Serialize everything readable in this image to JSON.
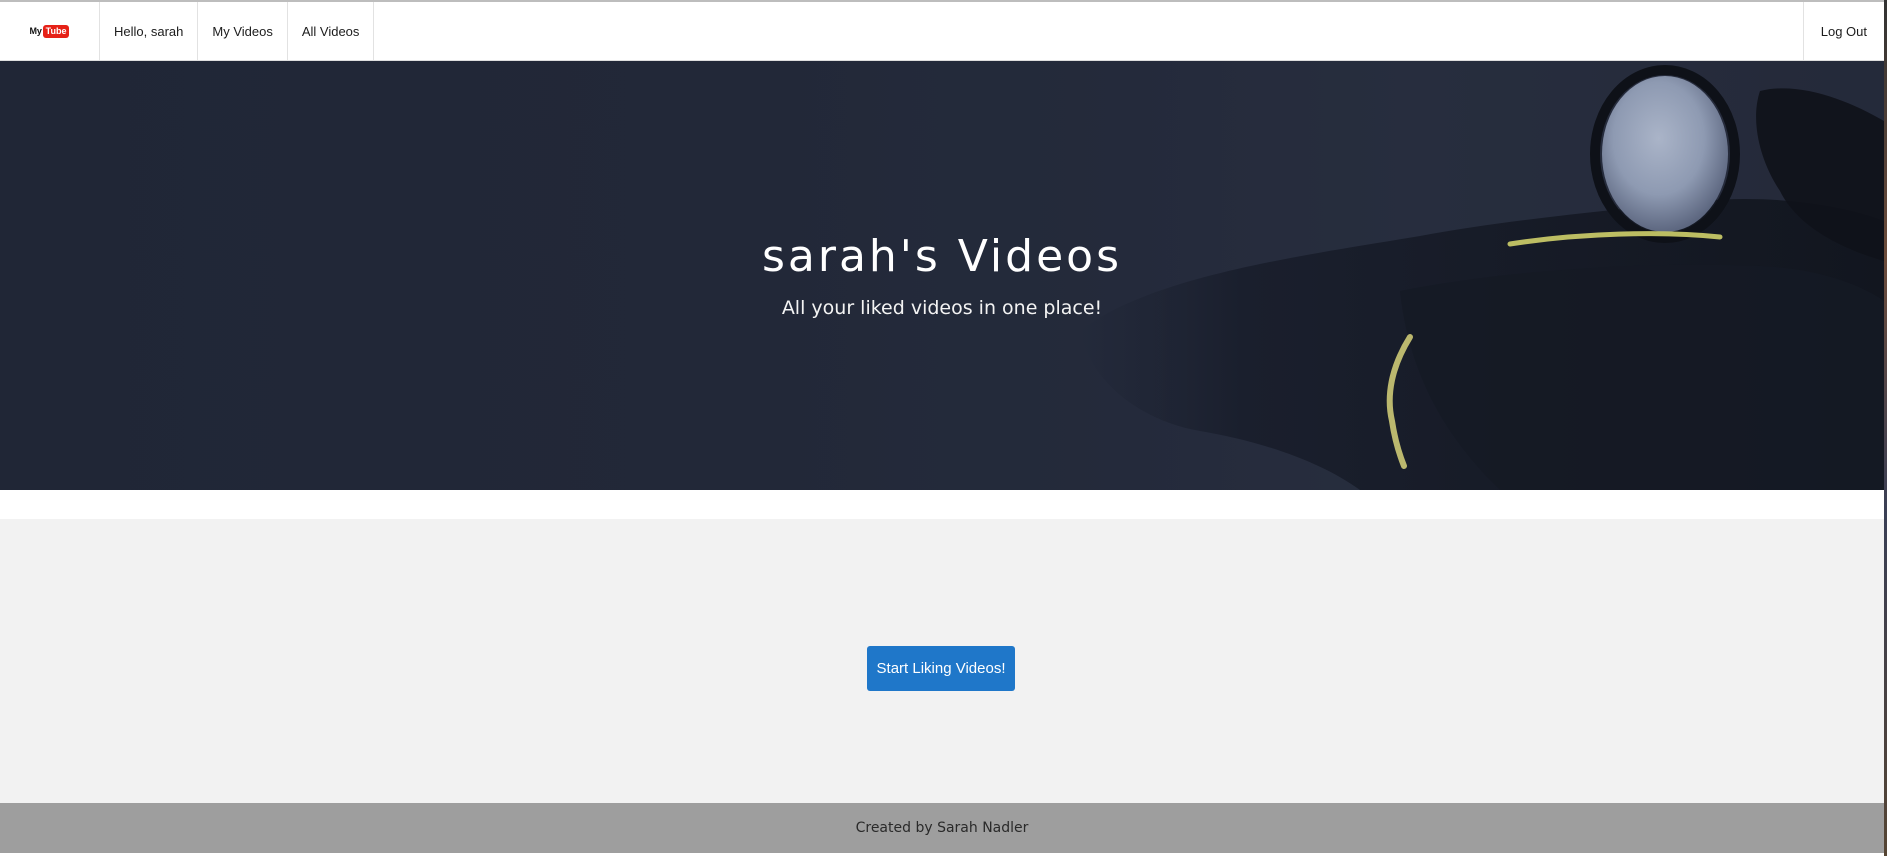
{
  "navbar": {
    "logo": {
      "my": "My",
      "tube": "Tube"
    },
    "items": [
      {
        "label": "Hello, sarah"
      },
      {
        "label": "My Videos"
      },
      {
        "label": "All Videos"
      }
    ],
    "logout_label": "Log Out"
  },
  "hero": {
    "title": "sarah's Videos",
    "subtitle": "All your liked videos in one place!"
  },
  "main": {
    "cta_label": "Start Liking Videos!"
  },
  "footer": {
    "text": "Created by Sarah Nadler"
  },
  "colors": {
    "accent": "#1f77c9",
    "hero_background": "#232a3a",
    "content_background": "#f2f2f2",
    "footer_background": "#9e9e9e",
    "logo_red": "#e62117"
  }
}
